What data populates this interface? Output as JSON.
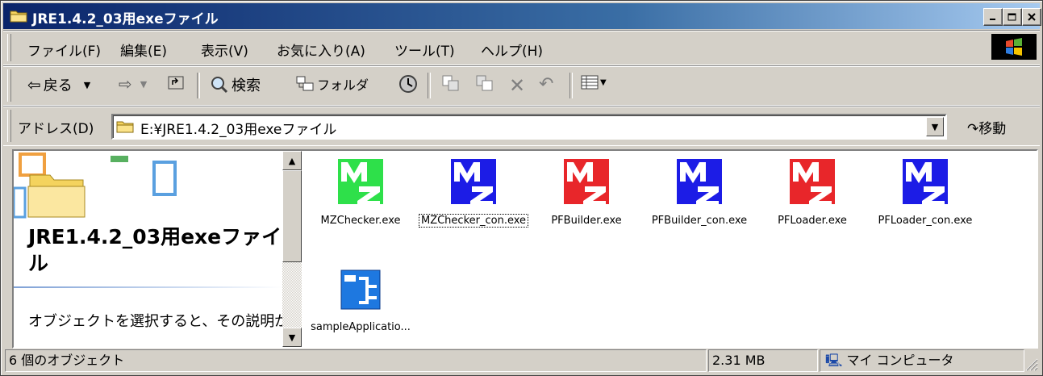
{
  "window": {
    "title": "JRE1.4.2_03用exeファイル",
    "buttons": {
      "minimize": "_",
      "maximize": "□",
      "close": "✕"
    }
  },
  "menubar": {
    "items": [
      "ファイル(F)",
      "編集(E)",
      "表示(V)",
      "お気に入り(A)",
      "ツール(T)",
      "ヘルプ(H)"
    ]
  },
  "toolbar": {
    "back_label": "戻る",
    "search_label": "検索",
    "folders_label": "フォルダ"
  },
  "addressbar": {
    "label": "アドレス(D)",
    "path": "E:¥JRE1.4.2_03用exeファイル",
    "go_label": "移動"
  },
  "left_pane": {
    "title": "JRE1.4.2_03用exeファイル",
    "description": "オブジェクトを選択すると、その説明が表示されます。"
  },
  "files": [
    {
      "name": "MZChecker.exe",
      "color": "#2ee04a",
      "icon": "mz-app-icon"
    },
    {
      "name": "MZChecker_con.exe",
      "color": "#1c1ce6",
      "icon": "mz-app-icon",
      "selected": true
    },
    {
      "name": "PFBuilder.exe",
      "color": "#e8262a",
      "icon": "mz-app-icon"
    },
    {
      "name": "PFBuilder_con.exe",
      "color": "#1c1ce6",
      "icon": "mz-app-icon"
    },
    {
      "name": "PFLoader.exe",
      "color": "#e8262a",
      "icon": "mz-app-icon"
    },
    {
      "name": "PFLoader_con.exe",
      "color": "#1c1ce6",
      "icon": "mz-app-icon"
    },
    {
      "name": "sampleApplicatio...",
      "color": "#1e78e0",
      "icon": "application-icon"
    }
  ],
  "statusbar": {
    "count": "6 個のオブジェクト",
    "size": "2.31 MB",
    "zone": "マイ コンピュータ"
  }
}
